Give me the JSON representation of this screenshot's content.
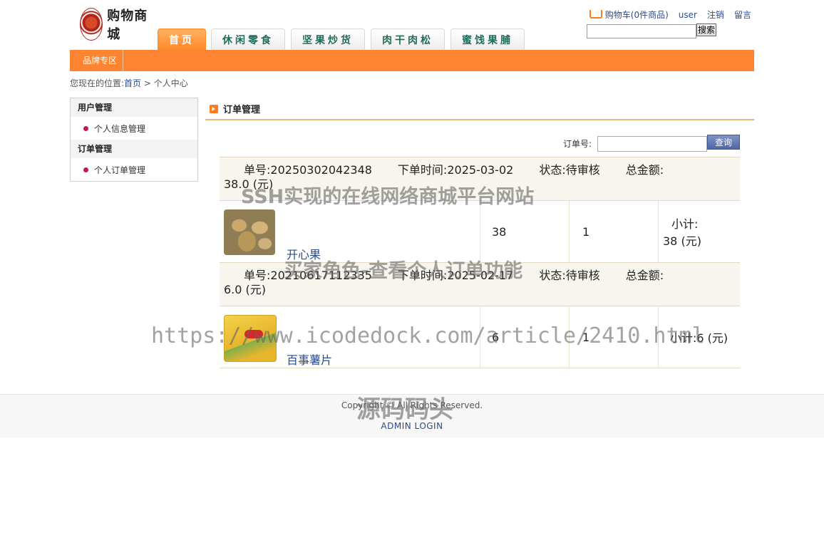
{
  "header": {
    "logo_text": "购物商城",
    "cart_label": "购物车(0件商品)",
    "user_label": "user",
    "logout_label": "注销",
    "message_label": "留言",
    "search_value": "",
    "search_button": "搜索"
  },
  "tabs": [
    {
      "label": "首页",
      "active": true
    },
    {
      "label": "休闲零食",
      "active": false
    },
    {
      "label": "坚果炒货",
      "active": false
    },
    {
      "label": "肉干肉松",
      "active": false
    },
    {
      "label": "蜜饯果脯",
      "active": false
    }
  ],
  "navbar": {
    "brand_link": "品牌专区"
  },
  "breadcrumb": {
    "prefix": "您现在的位置:",
    "home": "首页",
    "separator": ">",
    "current": "个人中心"
  },
  "sidebar": {
    "sections": [
      {
        "title": "用户管理",
        "items": [
          "个人信息管理"
        ]
      },
      {
        "title": "订单管理",
        "items": [
          "个人订单管理"
        ]
      }
    ]
  },
  "content": {
    "title": "订单管理",
    "order_no_label": "订单号:",
    "order_no_value": "",
    "query_button": "查询"
  },
  "orders": [
    {
      "number_label": "单号:",
      "number": "20250302042348",
      "time_label": "下单时间:",
      "time": "2025-03-02",
      "status_label": "状态:",
      "status": "待审核",
      "total_label": "总金额:",
      "total": "38.0 (元)",
      "item": {
        "name": "开心果",
        "price": "38",
        "qty": "1",
        "subtotal_label": "小计:",
        "subtotal": "38 (元)",
        "image": "pistachio"
      }
    },
    {
      "number_label": "单号:",
      "number": "20210617112335",
      "time_label": "下单时间:",
      "time": "2025-02-17",
      "status_label": "状态:",
      "status": "待审核",
      "total_label": "总金额:",
      "total": "6.0 (元)",
      "item": {
        "name": "百事薯片",
        "price": "6",
        "qty": "1",
        "subtotal_label": "小计:",
        "subtotal": "6 (元)",
        "image": "potato-chips"
      }
    }
  ],
  "footer": {
    "copyright": "Copyright © All Rights Reserved.",
    "admin_login": "ADMIN LOGIN"
  },
  "watermarks": [
    "SSH实现的在线网络商城平台网站",
    "买家角色-查看个人订单功能",
    "https://www.icodedock.com/article/2410.html",
    "源码码头"
  ]
}
